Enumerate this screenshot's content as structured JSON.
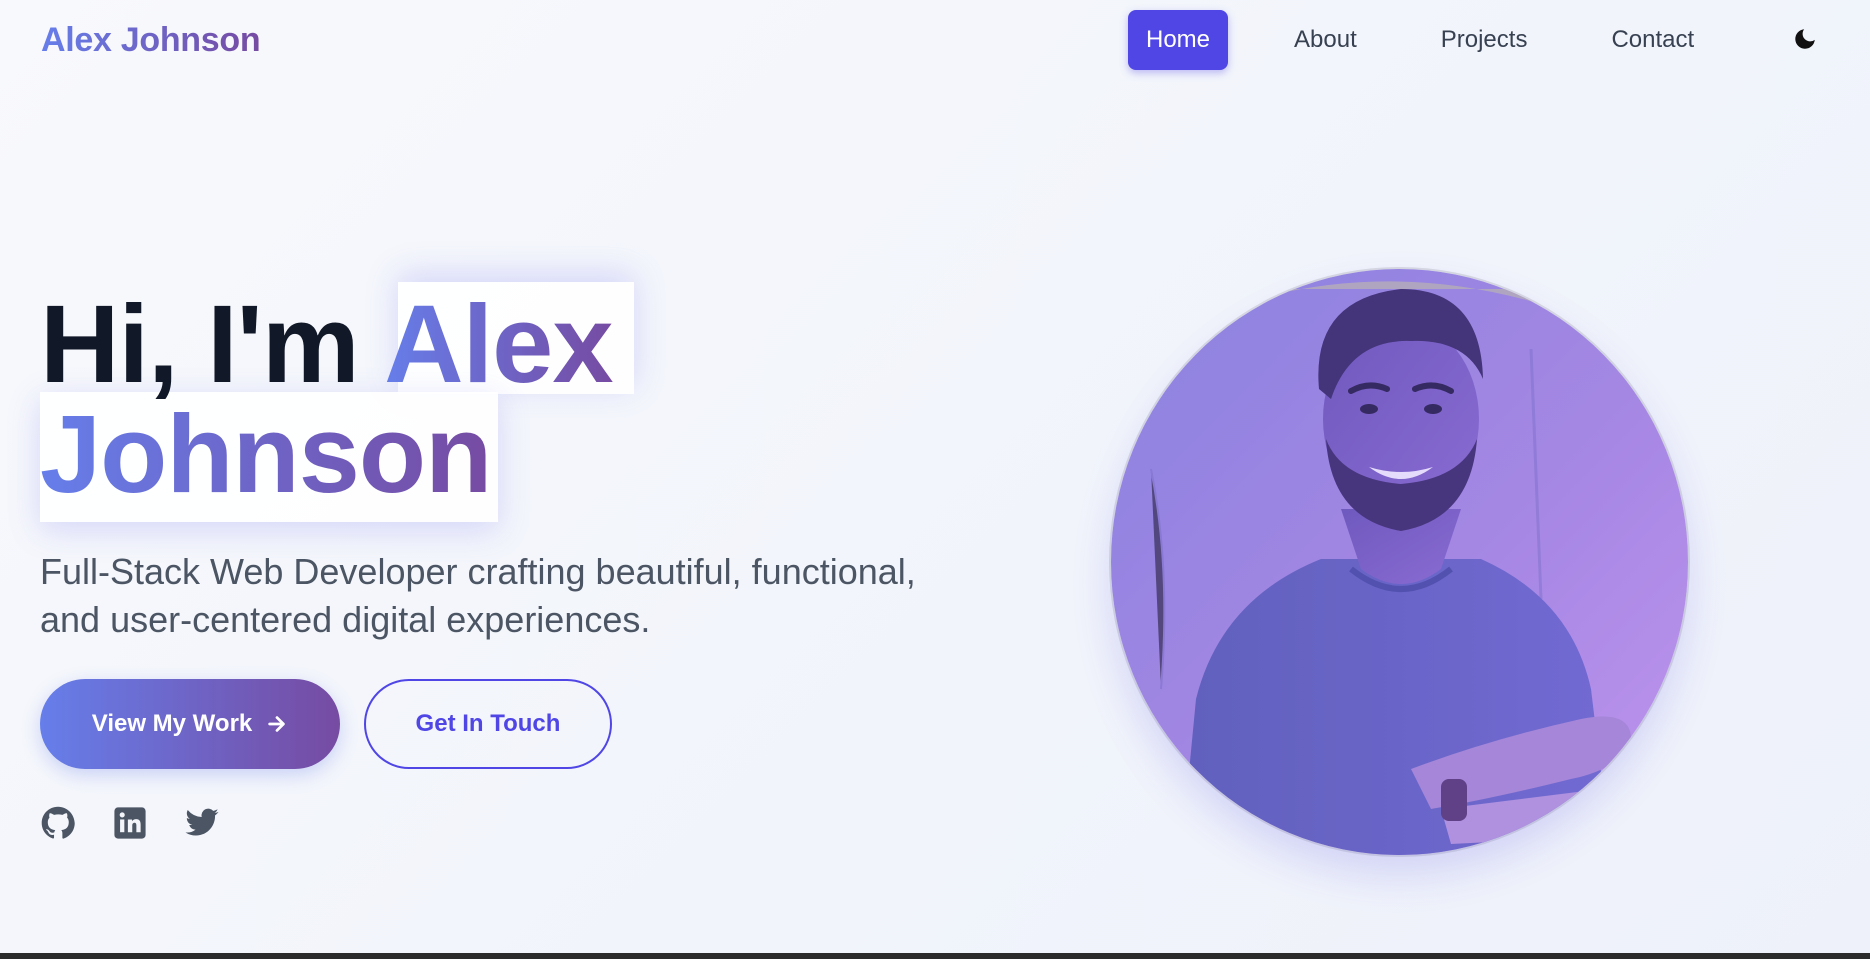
{
  "brand": {
    "name": "Alex Johnson"
  },
  "nav": {
    "items": [
      {
        "label": "Home",
        "active": true
      },
      {
        "label": "About",
        "active": false
      },
      {
        "label": "Projects",
        "active": false
      },
      {
        "label": "Contact",
        "active": false
      }
    ],
    "theme_toggle_icon": "moon-icon"
  },
  "hero": {
    "greeting": "Hi, I'm ",
    "name_first": "Alex",
    "name_last": "Johnson",
    "subtitle": "Full-Stack Web Developer crafting beautiful, functional, and user-centered digital experiences.",
    "primary_button": {
      "label": "View My Work",
      "icon": "arrow-right-icon"
    },
    "secondary_button": {
      "label": "Get In Touch"
    },
    "socials": [
      {
        "icon": "github-icon"
      },
      {
        "icon": "linkedin-icon"
      },
      {
        "icon": "twitter-icon"
      }
    ]
  },
  "colors": {
    "accent": "#4f46e5",
    "gradient_start": "#667eea",
    "gradient_end": "#764ba2",
    "text_dark": "#111827",
    "text_muted": "#4b5563"
  }
}
